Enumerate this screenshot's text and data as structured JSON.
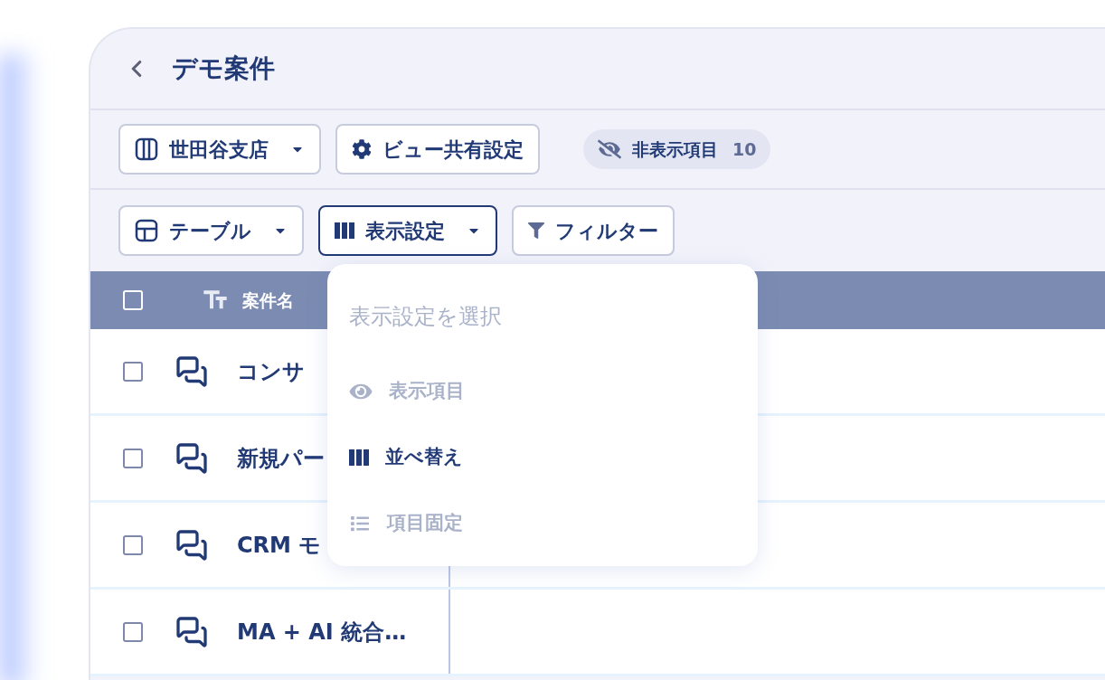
{
  "title": "デモ案件",
  "toolbar": [
    {
      "kind": "dropdown",
      "label": "世田谷支店"
    },
    {
      "kind": "button",
      "label": "ビュー共有設定"
    },
    {
      "kind": "badge",
      "label": "非表示項目",
      "count": "10"
    }
  ],
  "view_bar": [
    {
      "kind": "dropdown",
      "label": "テーブル",
      "open": false
    },
    {
      "kind": "dropdown",
      "label": "表示設定",
      "open": true
    },
    {
      "kind": "button",
      "label": "フィルター"
    }
  ],
  "table": {
    "header": {
      "checked": false,
      "label": "案件名"
    },
    "rows": [
      {
        "checked": false,
        "name": "コンサ"
      },
      {
        "checked": false,
        "name": "新規パー"
      },
      {
        "checked": false,
        "name": "CRM モ"
      },
      {
        "checked": false,
        "name": "MA + AI 統合…"
      }
    ]
  },
  "menu": {
    "placeholder": "表示設定を選択",
    "items": [
      {
        "label": "表示項目",
        "selected": false
      },
      {
        "label": "並べ替え",
        "selected": true
      },
      {
        "label": "項目固定",
        "selected": false
      }
    ]
  }
}
